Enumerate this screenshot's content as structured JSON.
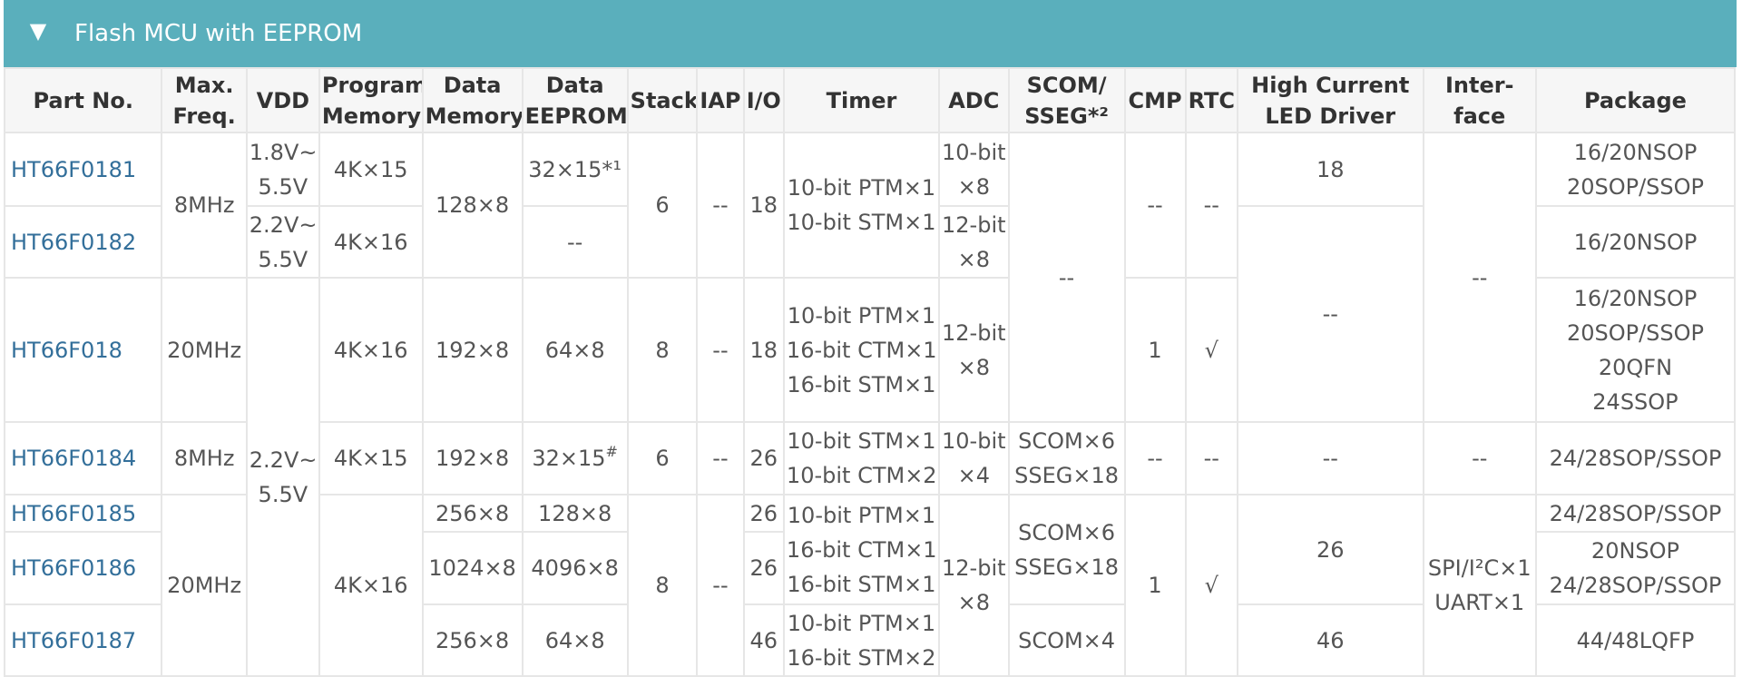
{
  "section": {
    "title": "Flash MCU with EEPROM",
    "collapse_icon": "triangle-down-icon"
  },
  "table": {
    "headers": {
      "part_no": "Part No.",
      "max_freq": [
        "Max.",
        "Freq."
      ],
      "vdd": "VDD",
      "program_memory": [
        "Program",
        "Memory"
      ],
      "data_memory": [
        "Data",
        "Memory"
      ],
      "data_eeprom": [
        "Data",
        "EEPROM"
      ],
      "stack": "Stack",
      "iap": "IAP",
      "io": "I/O",
      "timer": "Timer",
      "adc": "ADC",
      "scom": [
        "SCOM/",
        "SSEG*²"
      ],
      "cmp": "CMP",
      "rtc": "RTC",
      "led": [
        "High Current",
        "LED Driver"
      ],
      "interface": [
        "Inter-",
        "face"
      ],
      "package": "Package"
    },
    "cells": {
      "p181": "HT66F0181",
      "p182": "HT66F0182",
      "p18": "HT66F018",
      "p184": "HT66F0184",
      "p185": "HT66F0185",
      "p186": "HT66F0186",
      "p187": "HT66F0187",
      "freq_8a": "8MHz",
      "freq_20a": "20MHz",
      "freq_8b": "8MHz",
      "freq_20b": "20MHz",
      "vdd_181": [
        "1.8V~",
        "5.5V"
      ],
      "vdd_182": [
        "2.2V~",
        "5.5V"
      ],
      "vdd_rest": [
        "2.2V~",
        "5.5V"
      ],
      "prog_181": "4K×15",
      "prog_182": "4K×16",
      "prog_18": "4K×16",
      "prog_184": "4K×15",
      "prog_185_187": "4K×16",
      "dmem_181_182": "128×8",
      "dmem_18": "192×8",
      "dmem_184": "192×8",
      "dmem_185": "256×8",
      "dmem_186": "1024×8",
      "dmem_187": "256×8",
      "eep_181": "32×15*¹",
      "eep_182": "--",
      "eep_18": "64×8",
      "eep_184_base": "32×15",
      "eep_184_sup": "#",
      "eep_185": "128×8",
      "eep_186": "4096×8",
      "eep_187": "64×8",
      "stack_181_182": "6",
      "stack_18": "8",
      "stack_184": "6",
      "stack_185_187": "8",
      "iap_181_182": "--",
      "iap_18": "--",
      "iap_184": "--",
      "iap_185_187": "--",
      "io_181_182": "18",
      "io_18": "18",
      "io_184": "26",
      "io_185": "26",
      "io_186": "26",
      "io_187": "46",
      "timer_181_182": [
        "10-bit PTM×1",
        "10-bit STM×1"
      ],
      "timer_18": [
        "10-bit PTM×1",
        "16-bit CTM×1",
        "16-bit STM×1"
      ],
      "timer_184": [
        "10-bit STM×1",
        "10-bit CTM×2"
      ],
      "timer_185_186": [
        "10-bit PTM×1",
        "16-bit CTM×1",
        "16-bit STM×1"
      ],
      "timer_187": [
        "10-bit PTM×1",
        "16-bit STM×2"
      ],
      "adc_181": [
        "10-bit",
        "×8"
      ],
      "adc_182": [
        "12-bit",
        "×8"
      ],
      "adc_18": [
        "12-bit",
        "×8"
      ],
      "adc_184": [
        "10-bit",
        "×4"
      ],
      "adc_185_187": [
        "12-bit",
        "×8"
      ],
      "scom_181_18": "--",
      "scom_184": [
        "SCOM×6",
        "SSEG×18"
      ],
      "scom_185_186": [
        "SCOM×6",
        "SSEG×18"
      ],
      "scom_187": "SCOM×4",
      "cmp_181_182": "--",
      "cmp_18": "1",
      "cmp_184": "--",
      "cmp_185_187": "1",
      "rtc_181_182": "--",
      "rtc_18": "√",
      "rtc_184": "--",
      "rtc_185_187": "√",
      "led_181": "18",
      "led_182_18": "--",
      "led_184": "--",
      "led_185_186": "26",
      "led_187": "46",
      "if_181_18": "--",
      "if_184": "--",
      "if_185_187": [
        "SPI/I²C×1",
        "UART×1"
      ],
      "pkg_181": [
        "16/20NSOP",
        "20SOP/SSOP"
      ],
      "pkg_182": "16/20NSOP",
      "pkg_18": [
        "16/20NSOP",
        "20SOP/SSOP",
        "20QFN",
        "24SSOP"
      ],
      "pkg_184": "24/28SOP/SSOP",
      "pkg_185": "24/28SOP/SSOP",
      "pkg_186": [
        "20NSOP",
        "24/28SOP/SSOP"
      ],
      "pkg_187": "44/48LQFP"
    }
  },
  "colors": {
    "header_bg": "#5aafbc",
    "link": "#336f9a",
    "border": "#e6e6e6",
    "th_bg": "#f6f6f6"
  }
}
